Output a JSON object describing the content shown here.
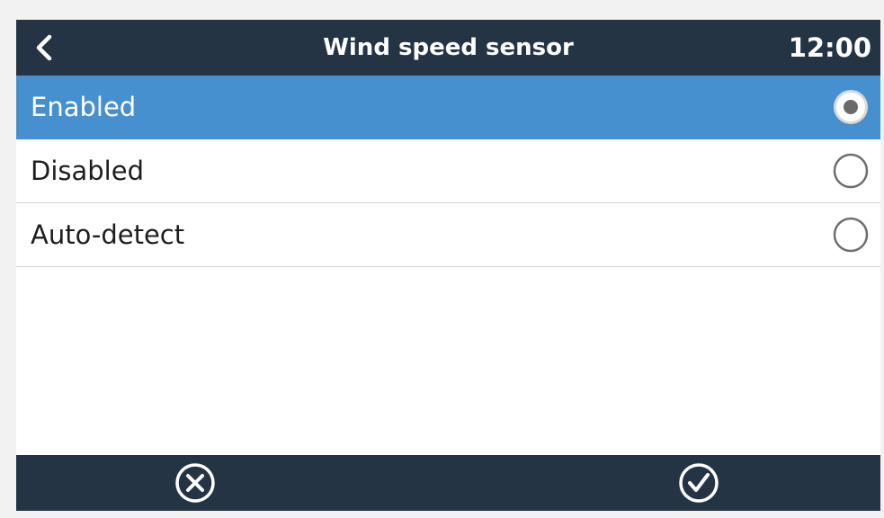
{
  "header": {
    "title": "Wind speed sensor",
    "time": "12:00",
    "back_icon": "chevron-left-icon"
  },
  "options": [
    {
      "label": "Enabled",
      "selected": true
    },
    {
      "label": "Disabled",
      "selected": false
    },
    {
      "label": "Auto-detect",
      "selected": false
    }
  ],
  "footer": {
    "cancel_icon": "cancel-circle-icon",
    "confirm_icon": "checkmark-circle-icon"
  },
  "colors": {
    "header_bg": "#253444",
    "selected_bg": "#4790d0",
    "page_bg": "#ffffff"
  }
}
